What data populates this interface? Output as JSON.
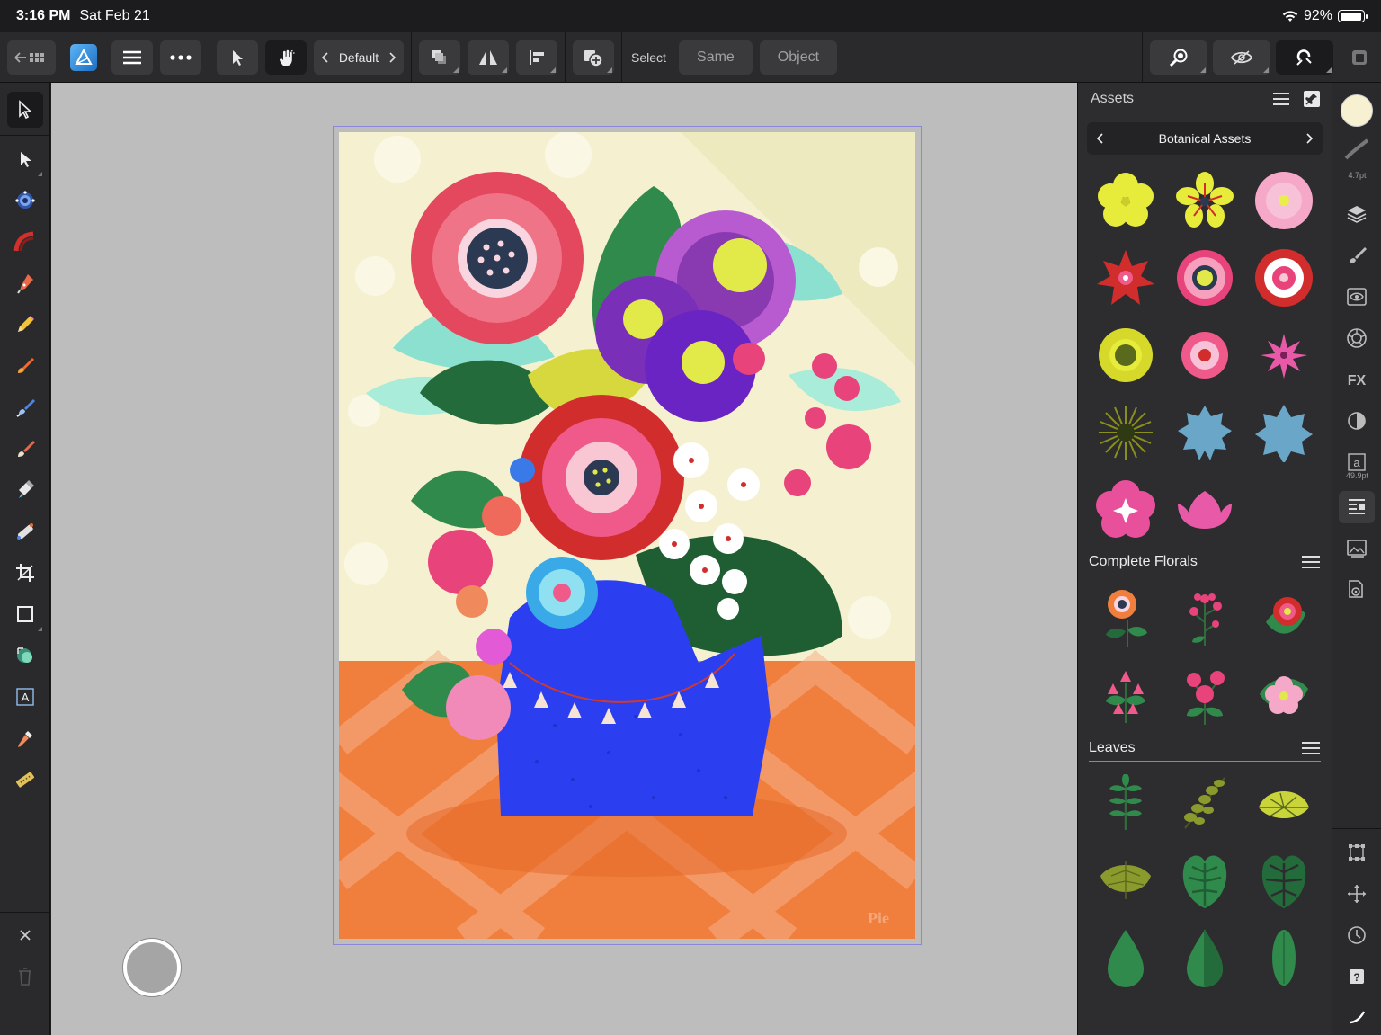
{
  "status": {
    "time": "3:16 PM",
    "date": "Sat Feb 21",
    "battery": "92%",
    "battery_level": 0.92
  },
  "toolbar": {
    "style_name": "Default",
    "select_label": "Select",
    "same_label": "Same",
    "object_label": "Object"
  },
  "assets": {
    "title": "Assets",
    "category": "Botanical Assets",
    "sections": {
      "complete_florals": "Complete Florals",
      "leaves": "Leaves"
    }
  },
  "studio": {
    "brush_size": "4.7pt",
    "font_size": "49.9pt"
  },
  "artwork": {
    "watermark": "Pie"
  },
  "colors": {
    "accent": "#5aa9f0",
    "primary_fill": "#f7f1d2",
    "toolbar_bg": "#2a2a2c",
    "canvas_bg": "#bdbdbd",
    "artboard_border": "#8c86d8"
  }
}
